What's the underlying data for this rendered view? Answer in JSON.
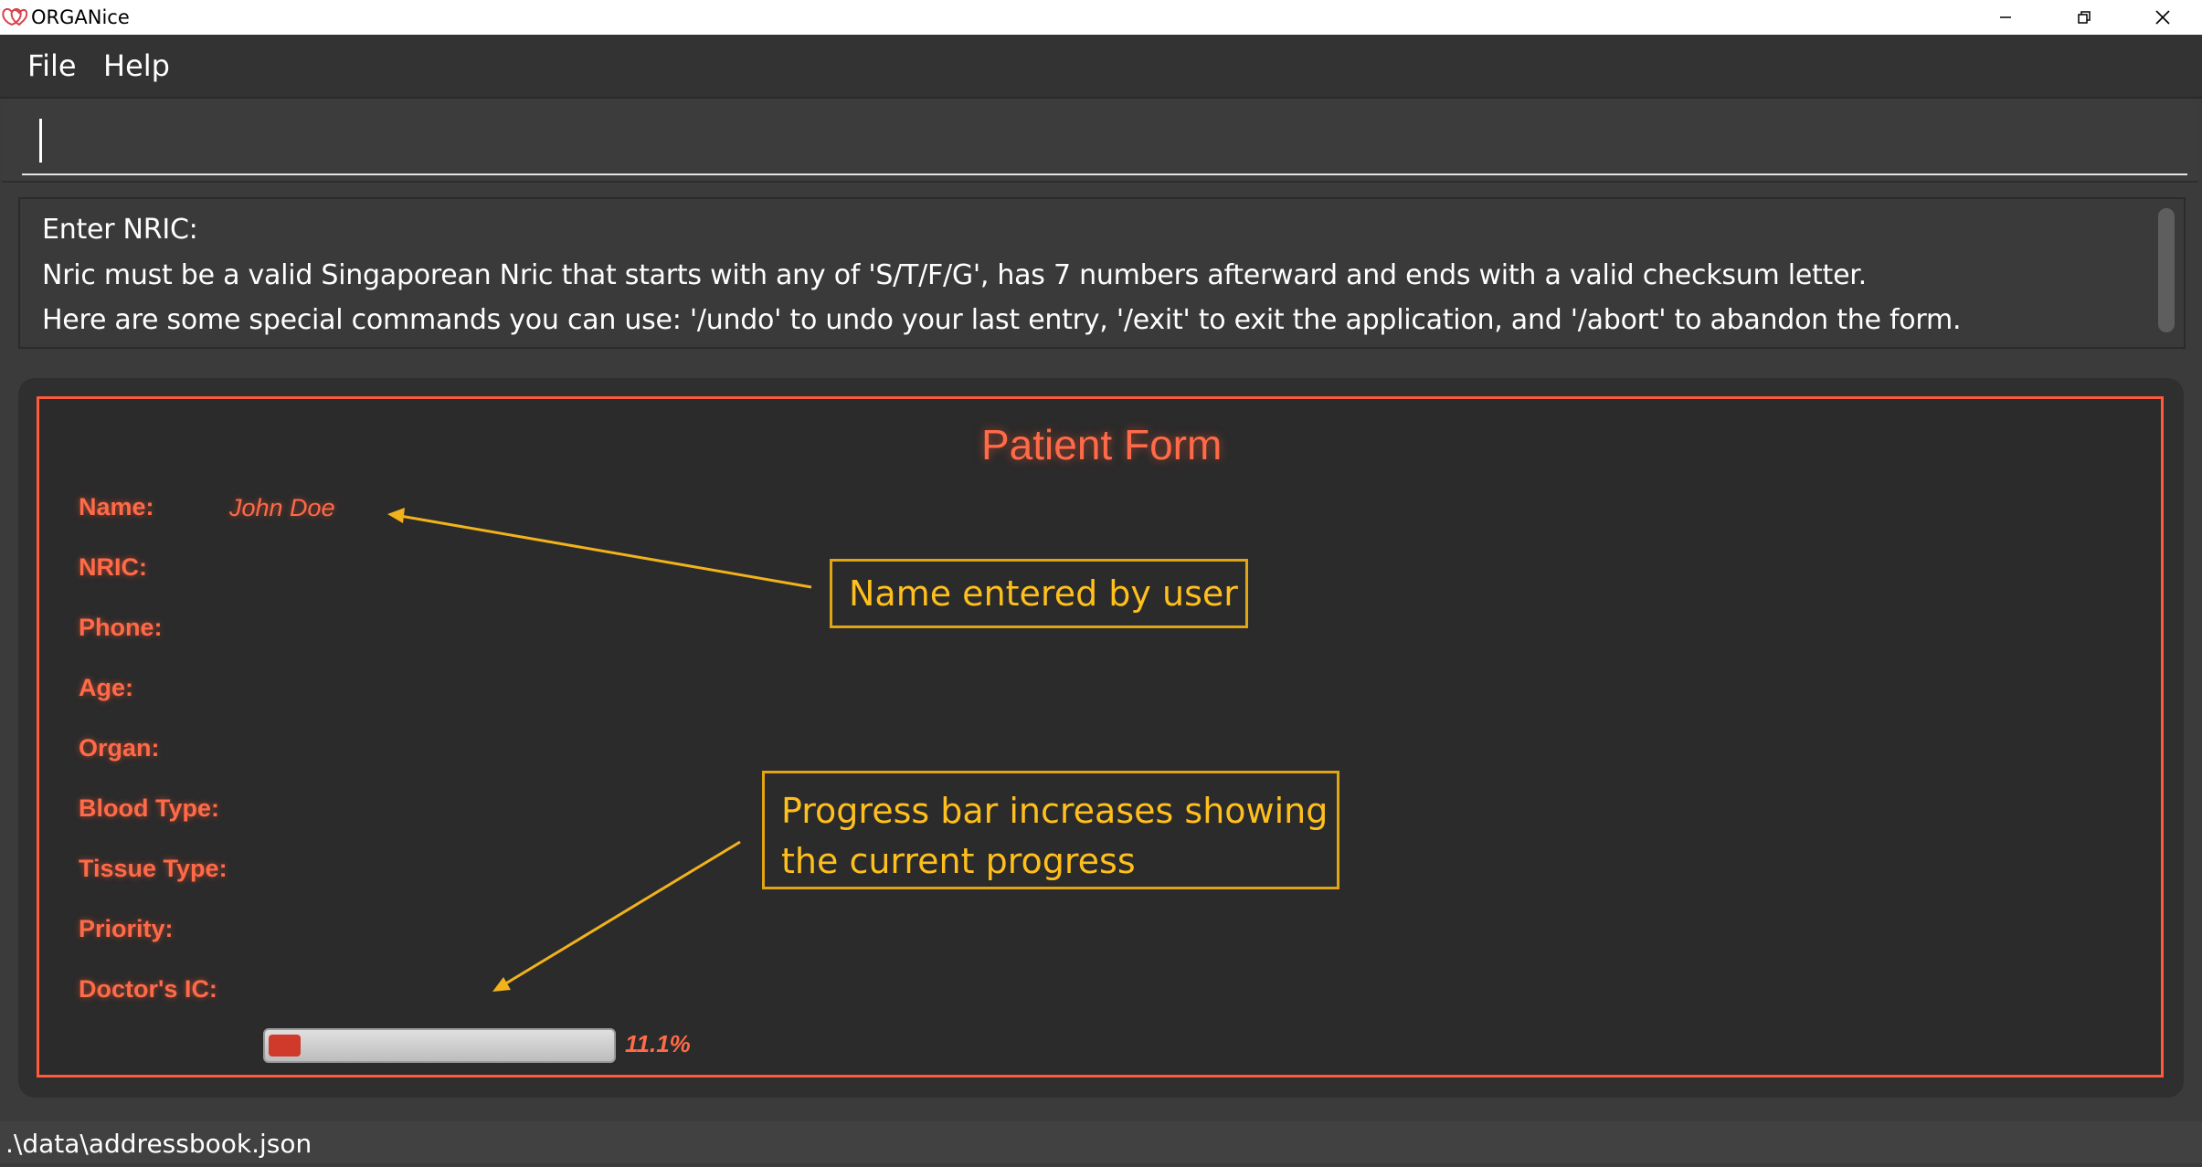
{
  "window": {
    "title": "ORGANice",
    "icon": "heart-icon",
    "controls": [
      "minimize-icon",
      "restore-icon",
      "close-icon"
    ]
  },
  "menu": {
    "items": [
      {
        "label": "File"
      },
      {
        "label": "Help"
      }
    ]
  },
  "command_box": {
    "value": "",
    "placeholder": ""
  },
  "result": {
    "lines": [
      "Enter NRIC:",
      "Nric must be a valid Singaporean Nric that starts with any of 'S/T/F/G', has 7 numbers afterward and ends with a valid checksum letter.",
      "Here are some special commands you can use: '/undo' to undo your last entry, '/exit' to exit the application, and '/abort' to abandon the form."
    ]
  },
  "form": {
    "title": "Patient Form",
    "fields": [
      {
        "label": "Name:",
        "value": "John Doe"
      },
      {
        "label": "NRIC:",
        "value": ""
      },
      {
        "label": "Phone:",
        "value": ""
      },
      {
        "label": "Age:",
        "value": ""
      },
      {
        "label": "Organ:",
        "value": ""
      },
      {
        "label": "Blood Type:",
        "value": ""
      },
      {
        "label": "Tissue Type:",
        "value": ""
      },
      {
        "label": "Priority:",
        "value": ""
      },
      {
        "label": "Doctor's IC:",
        "value": ""
      }
    ],
    "progress": {
      "fraction": 0.111,
      "text": "11.1%",
      "color": "#cf3a2a"
    }
  },
  "annotations": {
    "name_note": "Name entered by user",
    "progress_note_line1": "Progress bar increases showing",
    "progress_note_line2": "the current progress",
    "color": "#ffbf1c"
  },
  "status": {
    "path": ".\\data\\addressbook.json"
  },
  "colors": {
    "accent": "#ff5b3a",
    "background": "#3b3b3b",
    "form_background": "#2b2b2b"
  }
}
